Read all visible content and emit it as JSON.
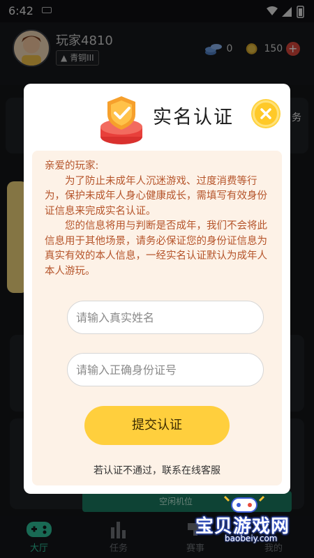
{
  "status_bar": {
    "time": "6:42"
  },
  "header": {
    "player_name": "玩家4810",
    "rank": "青铜III",
    "coins": "0",
    "gold": "150",
    "plus_symbol": "+"
  },
  "bottom_nav": {
    "items": [
      {
        "label": "大厅",
        "active": true
      },
      {
        "label": "任务"
      },
      {
        "label": "赛事"
      },
      {
        "label": "我的"
      }
    ]
  },
  "background": {
    "slot_label": "空闲机位",
    "side_peek_text": "务"
  },
  "watermark": {
    "text": "宝贝游戏网",
    "url": "baobeiy.com"
  },
  "modal": {
    "title": "实名认证",
    "greeting": "亲爱的玩家:",
    "paragraph_1": "为了防止未成年人沉迷游戏、过度消费等行为，保护未成年人身心健康成长，需填写有效身份证信息来完成实名认证。",
    "paragraph_2": "您的信息将用与判断是否成年，我们不会将此信息用于其他场景，请务必保证您的身份证信息为真实有效的本人信息，一经实名认证默认为成年人本人游玩。",
    "name_placeholder": "请输入真实姓名",
    "id_placeholder": "请输入正确身份证号",
    "submit_label": "提交认证",
    "support_text": "若认证不通过，联系在线客服"
  },
  "colors": {
    "accent_yellow": "#ffcf3d",
    "notice_bg": "#fdf2e7",
    "notice_text": "#b5542a",
    "nav_active": "#2fc29a"
  }
}
